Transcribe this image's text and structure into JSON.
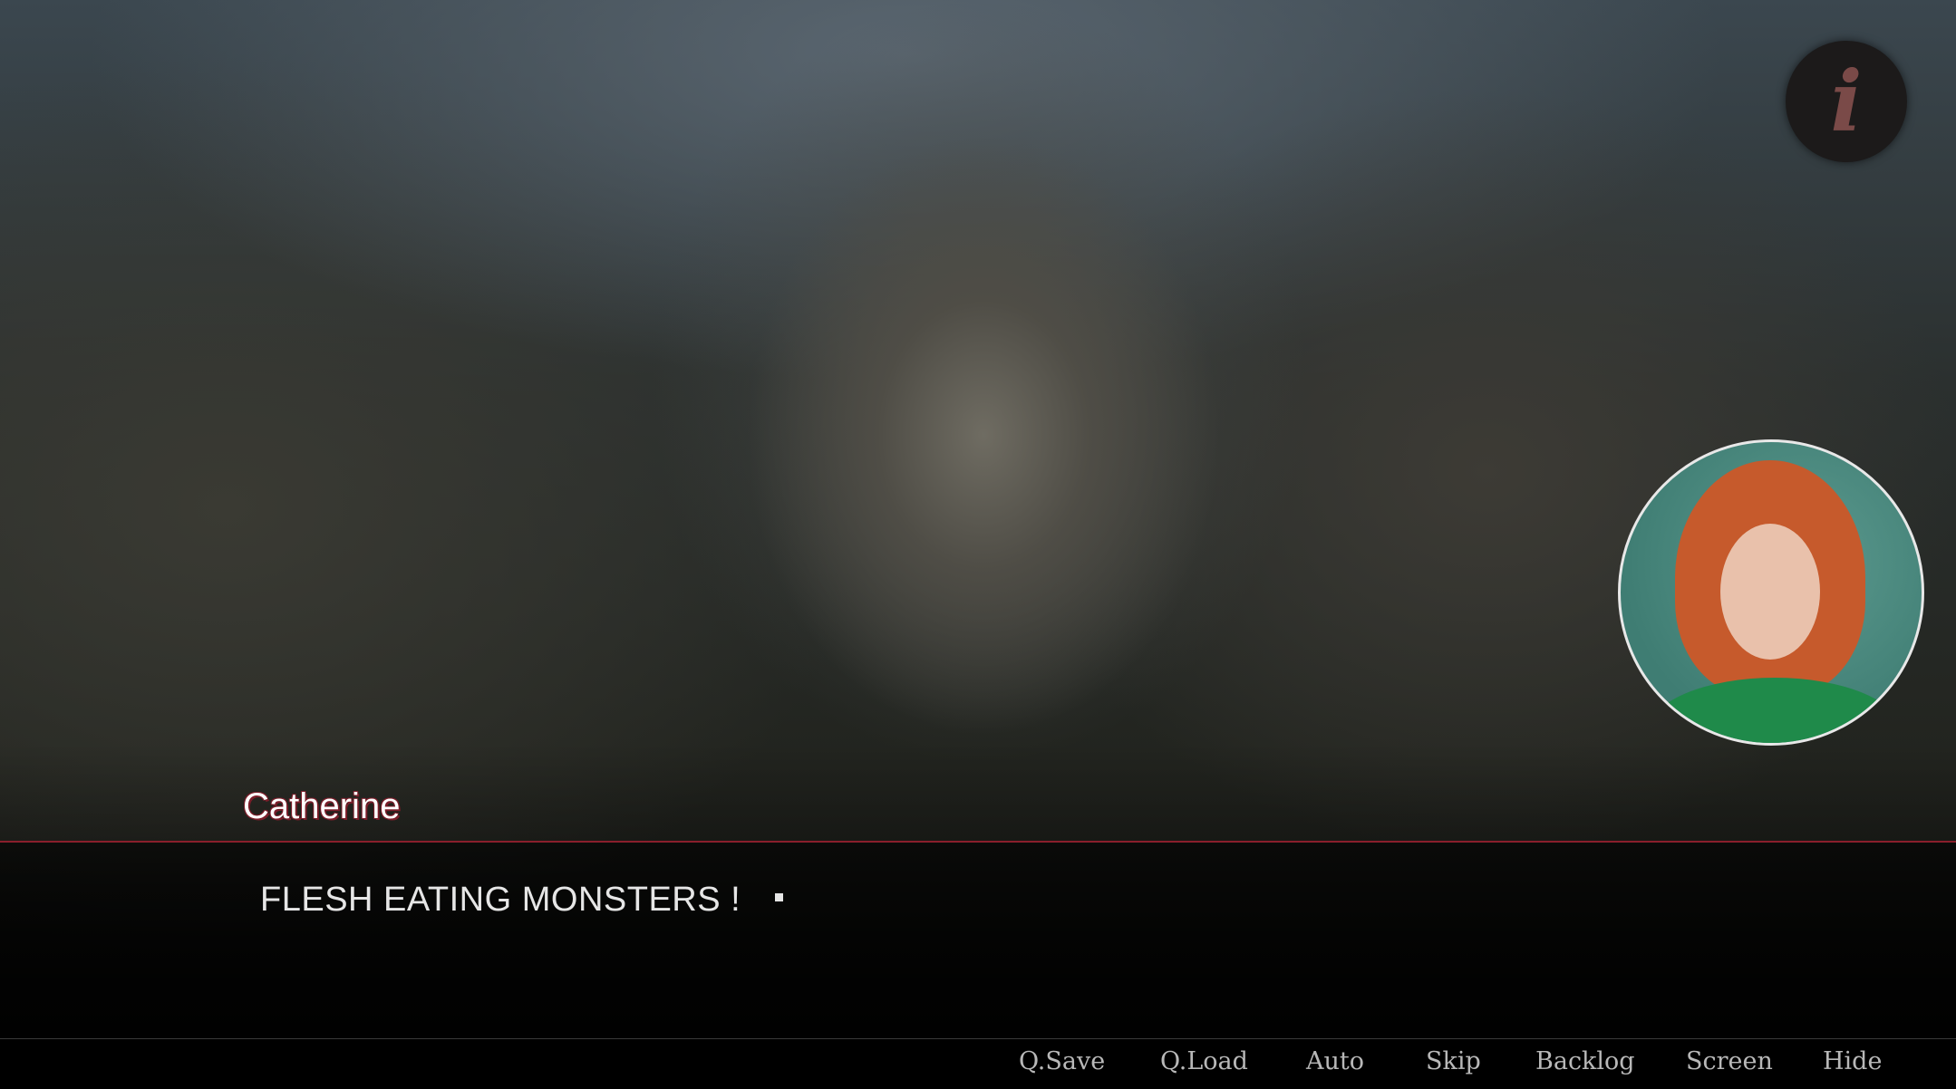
{
  "dialogue": {
    "speaker": "Catherine",
    "text": "FLESH EATING MONSTERS !"
  },
  "menu": {
    "items": [
      "Q.Save",
      "Q.Load",
      "Auto",
      "Skip",
      "Backlog",
      "Screen",
      "Hide"
    ]
  },
  "icons": {
    "info": "i"
  },
  "colors": {
    "accent": "#8a1f2c",
    "name_outline": "#7a1e2a",
    "info_glyph": "#7a4a48"
  }
}
